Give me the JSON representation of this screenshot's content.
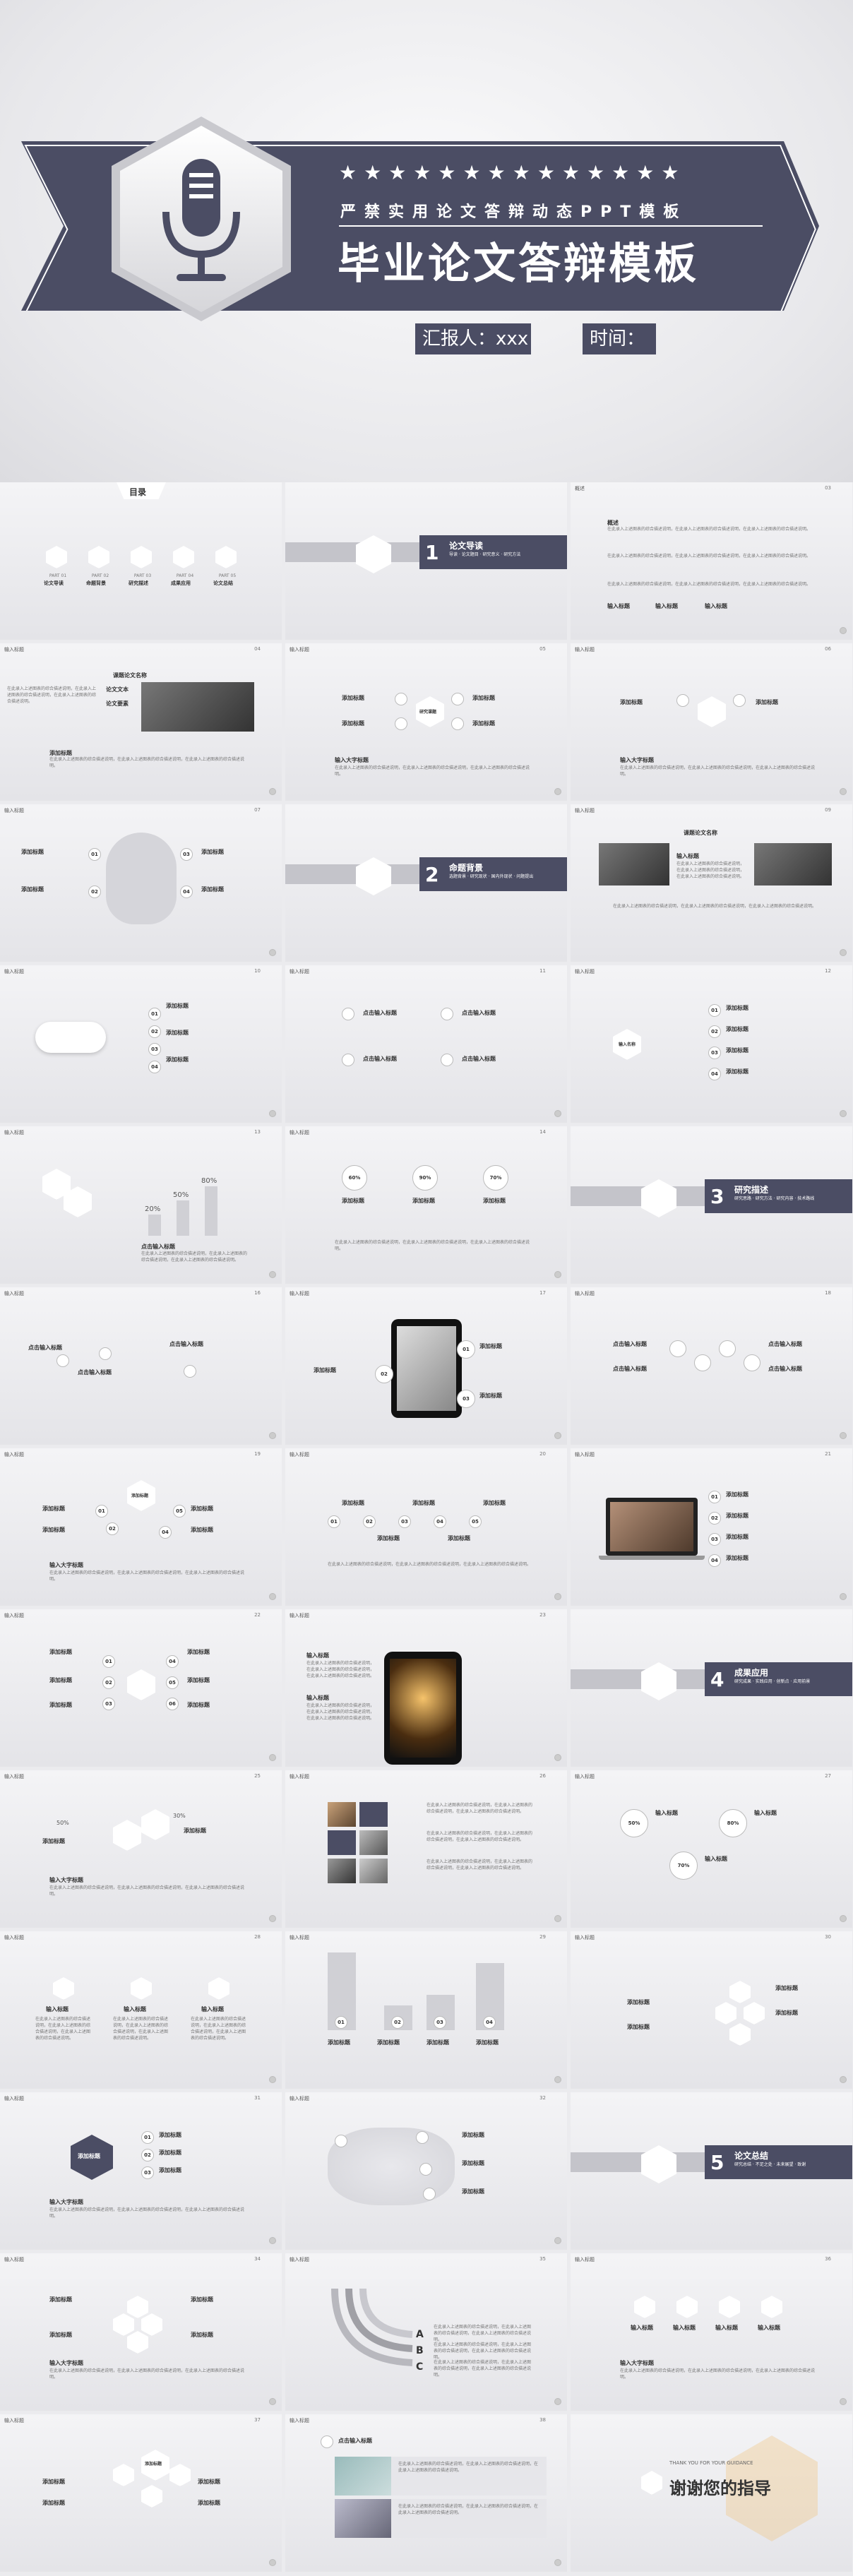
{
  "cover": {
    "stars": "★★★★★★★★★★★★★★",
    "subtitle": "严禁实用论文答辩动态PPT模板",
    "title": "毕业论文答辩模板",
    "reporter": "汇报人：xxx",
    "time_label": "时间："
  },
  "toc": {
    "title": "目录",
    "items": [
      {
        "part": "PART 01",
        "label": "论文导读"
      },
      {
        "part": "PART 02",
        "label": "命题背景"
      },
      {
        "part": "PART 03",
        "label": "研究描述"
      },
      {
        "part": "PART 04",
        "label": "成果应用"
      },
      {
        "part": "PART 05",
        "label": "论文总结"
      }
    ]
  },
  "sections": [
    {
      "num": "1",
      "title": "论文导读",
      "items": [
        "导读",
        "论文题目",
        "研究意义",
        "研究方法"
      ]
    },
    {
      "num": "2",
      "title": "命题背景",
      "items": [
        "选题背景",
        "研究现状",
        "国内外现状",
        "问题提出"
      ]
    },
    {
      "num": "3",
      "title": "研究描述",
      "items": [
        "研究思路",
        "研究方法",
        "研究内容",
        "技术路线"
      ]
    },
    {
      "num": "4",
      "title": "成果应用",
      "items": [
        "研究成果",
        "实践应用",
        "创新点",
        "应用前景"
      ]
    },
    {
      "num": "5",
      "title": "论文总结",
      "items": [
        "研究总结",
        "不足之处",
        "未来展望",
        "致谢"
      ]
    }
  ],
  "common": {
    "add_title": "添加标题",
    "input_title": "输入标题",
    "input_big_title": "输入大字标题",
    "click_add": "点击输入标题",
    "lorem": "在此录入上述图表的综合描述说明，在此录入上述图表的综合描述说明，在此录入上述图表的综合描述说明。",
    "intro_label": "概述",
    "paper_text": "论文文本",
    "paper_elements": "论文要素",
    "research_topic": "研究课题",
    "thesis_name": "课题论文名称",
    "input_me": "输入名称"
  },
  "pages": [
    "01",
    "02",
    "03",
    "04",
    "05",
    "06",
    "07",
    "08",
    "09",
    "10",
    "11",
    "12",
    "13",
    "14",
    "15",
    "16",
    "17",
    "18",
    "19",
    "20",
    "21",
    "22",
    "23",
    "24",
    "25",
    "26",
    "27",
    "28",
    "29",
    "30",
    "31",
    "32",
    "33",
    "34",
    "35",
    "36",
    "37",
    "38"
  ],
  "percents": [
    "20%",
    "50%",
    "80%",
    "60%",
    "90%",
    "70%",
    "30%",
    "50%"
  ],
  "abc": [
    "A",
    "B",
    "C"
  ],
  "thanks": {
    "en": "THANK YOU FOR YOUR GUIDANCE",
    "cn": "谢谢您的指导"
  },
  "colors": {
    "dark": "#4b4d64",
    "light": "#ebebee",
    "accent": "#f0c27a"
  }
}
